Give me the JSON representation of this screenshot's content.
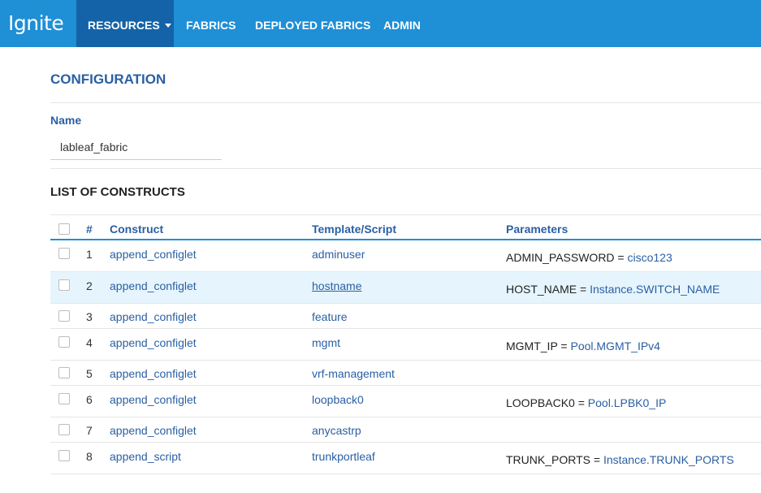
{
  "nav": {
    "logo": "Ignite",
    "items": [
      {
        "label": "RESOURCES",
        "dropdown": true,
        "active": true
      },
      {
        "label": "FABRICS"
      },
      {
        "label": "DEPLOYED FABRICS"
      },
      {
        "label": "ADMIN"
      }
    ]
  },
  "config": {
    "title": "CONFIGURATION",
    "name_label": "Name",
    "name_value": "lableaf_fabric"
  },
  "constructs": {
    "title": "LIST OF CONSTRUCTS",
    "columns": {
      "num": "#",
      "construct": "Construct",
      "template": "Template/Script",
      "parameters": "Parameters"
    },
    "rows": [
      {
        "num": "1",
        "construct": "append_configlet",
        "template": "adminuser",
        "param_key": "ADMIN_PASSWORD = ",
        "param_val": "cisco123"
      },
      {
        "num": "2",
        "construct": "append_configlet",
        "template": "hostname",
        "param_key": "HOST_NAME = ",
        "param_val": "Instance.SWITCH_NAME",
        "hovered": true
      },
      {
        "num": "3",
        "construct": "append_configlet",
        "template": "feature",
        "param_key": "",
        "param_val": ""
      },
      {
        "num": "4",
        "construct": "append_configlet",
        "template": "mgmt",
        "param_key": "MGMT_IP = ",
        "param_val": "Pool.MGMT_IPv4"
      },
      {
        "num": "5",
        "construct": "append_configlet",
        "template": "vrf-management",
        "param_key": "",
        "param_val": ""
      },
      {
        "num": "6",
        "construct": "append_configlet",
        "template": "loopback0",
        "param_key": "LOOPBACK0 = ",
        "param_val": "Pool.LPBK0_IP"
      },
      {
        "num": "7",
        "construct": "append_configlet",
        "template": "anycastrp",
        "param_key": "",
        "param_val": ""
      },
      {
        "num": "8",
        "construct": "append_script",
        "template": "trunkportleaf",
        "param_key": "TRUNK_PORTS = ",
        "param_val": "Instance.TRUNK_PORTS"
      }
    ]
  },
  "colors": {
    "nav_bg": "#1f8fd6",
    "nav_active": "#1463a8",
    "accent_text": "#2a5fa3",
    "row_hover": "#e6f5fd"
  }
}
